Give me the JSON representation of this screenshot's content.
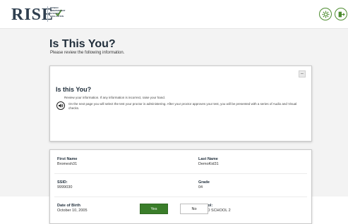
{
  "header": {
    "logo_text": "RISE",
    "logo_tagline": "ROWAN INDEPENDENT SYSTEM EVALUATION",
    "settings_icon": "gear-icon",
    "logout_icon": "logout-icon",
    "accent_color": "#4d8c2f"
  },
  "page": {
    "title": "Is This You?",
    "subtitle": "Please review the following information."
  },
  "instructions": {
    "heading": "Is this You?",
    "line1": "Review your information. If any information is incorrect, raise your hand.",
    "line2": "On the next page you will select the test your proctor is administering. After your proctor approves your test, you will be presented with a series of Audio and Visual checks.",
    "collapse_label": "–",
    "audio_icon": "speaker-icon"
  },
  "student_info": {
    "first_name_label": "First Name",
    "first_name_value": "Bromesh31",
    "last_name_label": "Last Name",
    "last_name_value": "DemoKid31",
    "ssid_label": "SSID:",
    "ssid_value": "9999030",
    "grade_label": "Grade",
    "grade_value": "04",
    "dob_label": "Date of Birth",
    "dob_value": "October 10, 2005",
    "school_label": "School:",
    "school_value": "DEMO SCHOOL 2"
  },
  "footer": {
    "yes_label": "Yes",
    "no_label": "No",
    "yes_color": "#3a7d2a"
  }
}
